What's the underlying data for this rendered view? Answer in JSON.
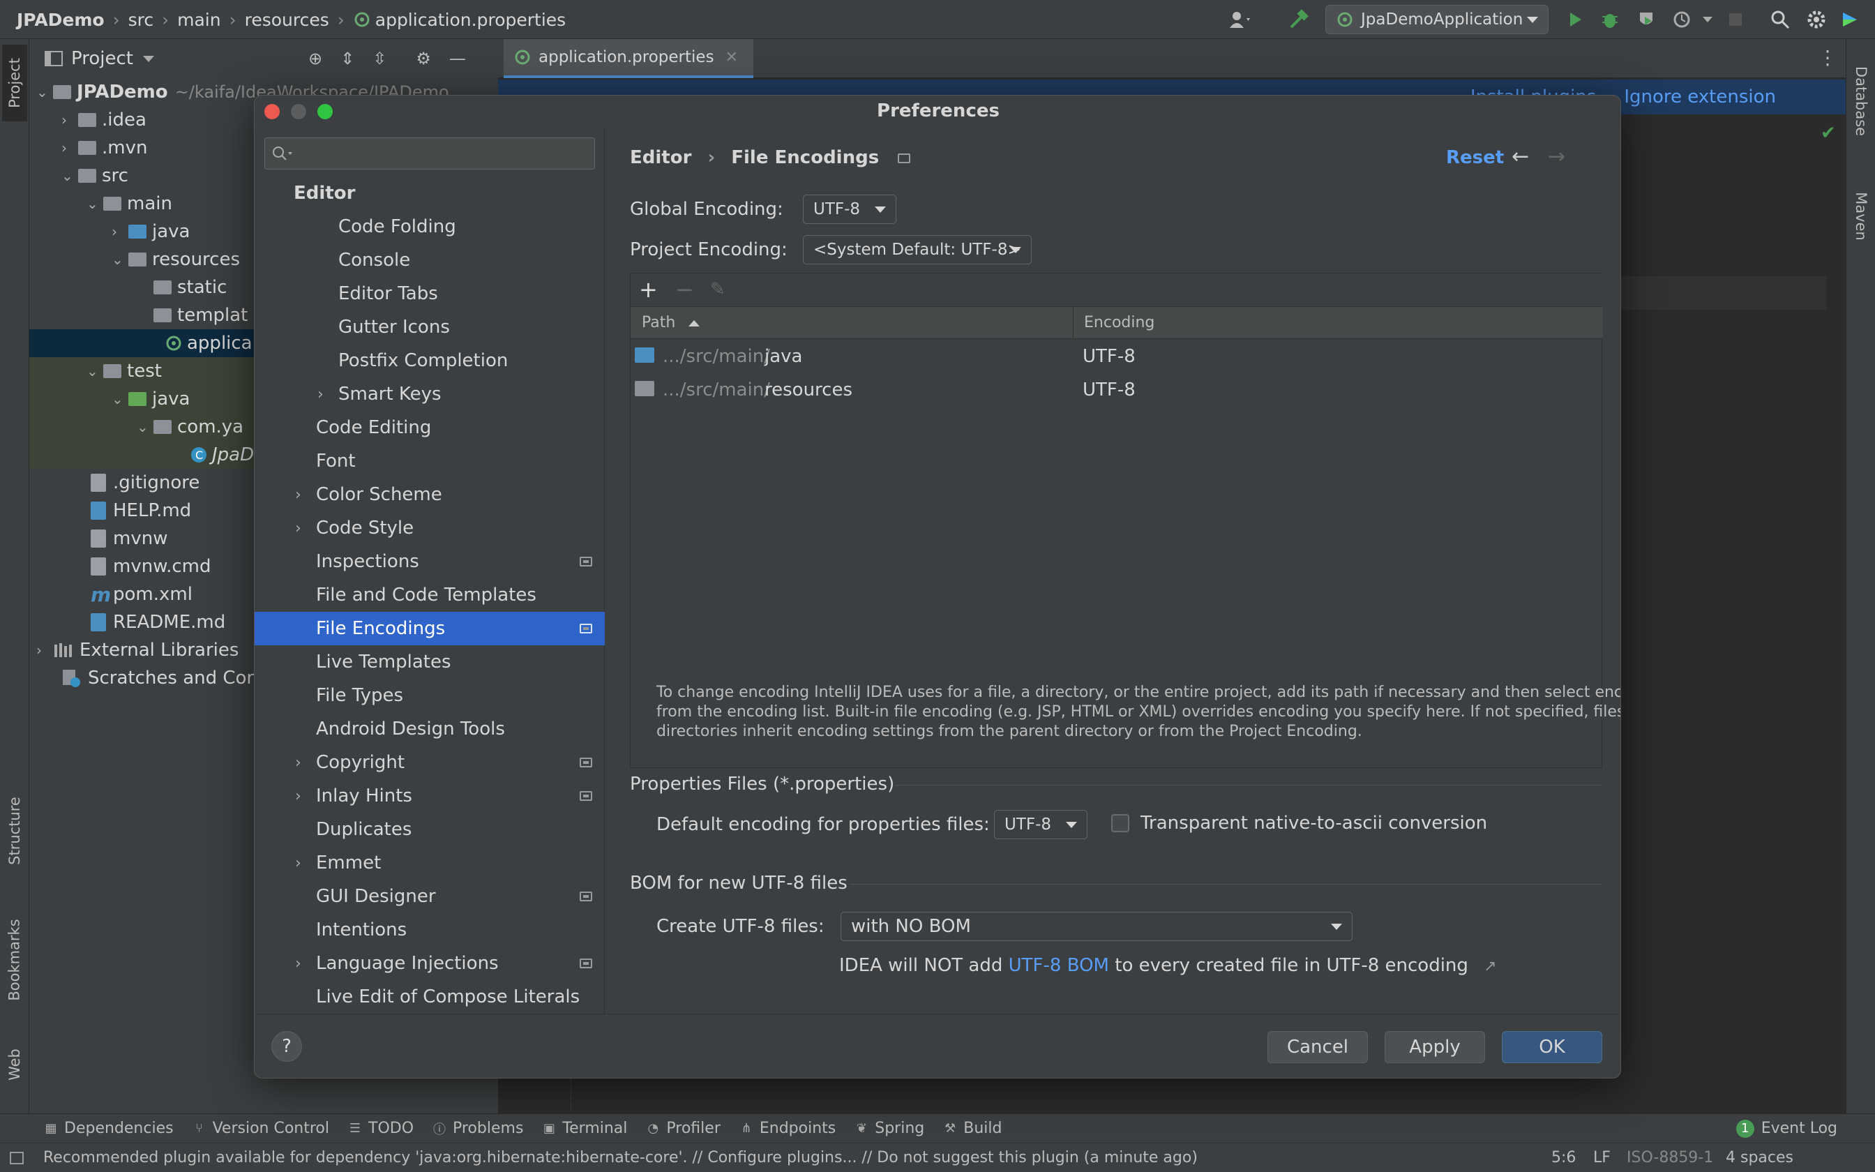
{
  "breadcrumb": {
    "items": [
      "JPADemo",
      "src",
      "main",
      "resources",
      "application.properties"
    ]
  },
  "run_config": {
    "label": "JpaDemoApplication"
  },
  "project_panel": {
    "title": "Project",
    "tree": [
      {
        "label": "JPADemo",
        "extra": "~/kaifa/IdeaWorkspace/JPADemo",
        "kind": "module"
      },
      {
        "label": ".idea",
        "kind": "folder"
      },
      {
        "label": ".mvn",
        "kind": "folder"
      },
      {
        "label": "src",
        "kind": "folder"
      },
      {
        "label": "main",
        "kind": "folder"
      },
      {
        "label": "java",
        "kind": "folder-blue"
      },
      {
        "label": "resources",
        "kind": "folder-res"
      },
      {
        "label": "static",
        "kind": "folder"
      },
      {
        "label": "templat",
        "kind": "folder"
      },
      {
        "label": "applica",
        "kind": "file-leaf"
      },
      {
        "label": "test",
        "kind": "folder"
      },
      {
        "label": "java",
        "kind": "folder-green"
      },
      {
        "label": "com.ya",
        "kind": "package"
      },
      {
        "label": "JpaD",
        "kind": "class"
      },
      {
        "label": ".gitignore",
        "kind": "file"
      },
      {
        "label": "HELP.md",
        "kind": "file-md"
      },
      {
        "label": "mvnw",
        "kind": "file"
      },
      {
        "label": "mvnw.cmd",
        "kind": "file"
      },
      {
        "label": "pom.xml",
        "kind": "file-m"
      },
      {
        "label": "README.md",
        "kind": "file-md"
      },
      {
        "label": "External Libraries",
        "kind": "lib"
      },
      {
        "label": "Scratches and Con",
        "kind": "scratch"
      }
    ]
  },
  "left_stripe": {
    "project": "Project",
    "structure": "Structure",
    "bookmarks": "Bookmarks",
    "web": "Web"
  },
  "right_stripe": {
    "database": "Database",
    "maven": "Maven"
  },
  "editor": {
    "tab": "application.properties",
    "banner_link1": "Install plugins",
    "banner_link2": "Ignore extension"
  },
  "dialog": {
    "title": "Preferences",
    "search_placeholder": "",
    "nav": {
      "group": "Editor",
      "items": [
        "Code Folding",
        "Console",
        "Editor Tabs",
        "Gutter Icons",
        "Postfix Completion",
        "Smart Keys",
        "Code Editing",
        "Font",
        "Color Scheme",
        "Code Style",
        "Inspections",
        "File and Code Templates",
        "File Encodings",
        "Live Templates",
        "File Types",
        "Android Design Tools",
        "Copyright",
        "Inlay Hints",
        "Duplicates",
        "Emmet",
        "GUI Designer",
        "Intentions",
        "Language Injections",
        "Live Edit of Compose Literals"
      ]
    },
    "header": {
      "section": "Editor",
      "page": "File Encodings",
      "reset": "Reset"
    },
    "global_encoding": {
      "label": "Global Encoding:",
      "value": "UTF-8"
    },
    "project_encoding": {
      "label": "Project Encoding:",
      "value": "<System Default: UTF-8>"
    },
    "table": {
      "columns": [
        "Path",
        "Encoding"
      ],
      "rows": [
        {
          "path_prefix": ".../src/main/",
          "path_name": "java",
          "encoding": "UTF-8"
        },
        {
          "path_prefix": ".../src/main/",
          "path_name": "resources",
          "encoding": "UTF-8"
        }
      ]
    },
    "help_text": [
      "To change encoding IntelliJ IDEA uses for a file, a directory, or the entire project, add its path if necessary and then select encoding",
      "from the encoding list. Built-in file encoding (e.g. JSP, HTML or XML) overrides encoding you specify here. If not specified, files and",
      "directories inherit encoding settings from the parent directory or from the Project Encoding."
    ],
    "properties_section": {
      "title": "Properties Files (*.properties)",
      "default_label": "Default encoding for properties files:",
      "default_value": "UTF-8",
      "transparent_label": "Transparent native-to-ascii conversion",
      "transparent_checked": false
    },
    "bom_section": {
      "title": "BOM for new UTF-8 files",
      "create_label": "Create UTF-8 files:",
      "create_value": "with NO BOM",
      "note_pre": "IDEA will NOT add ",
      "note_link": "UTF-8 BOM",
      "note_post": " to every created file in UTF-8 encoding",
      "note_arrow": "↗"
    },
    "buttons": {
      "help": "?",
      "cancel": "Cancel",
      "apply": "Apply",
      "ok": "OK"
    }
  },
  "bottom_tools": [
    "Dependencies",
    "Version Control",
    "TODO",
    "Problems",
    "Terminal",
    "Profiler",
    "Endpoints",
    "Spring",
    "Build"
  ],
  "event_log": {
    "count": "1",
    "label": "Event Log"
  },
  "status": {
    "message": "Recommended plugin available for dependency 'java:org.hibernate:hibernate-core'. // Configure plugins... // Do not suggest this plugin (a minute ago)",
    "position": "5:6",
    "line_sep": "LF",
    "encoding": "ISO-8859-1",
    "indent": "4 spaces"
  },
  "colors": {
    "accent": "#2f65ca",
    "link": "#589df6",
    "run_green": "#499c54"
  }
}
